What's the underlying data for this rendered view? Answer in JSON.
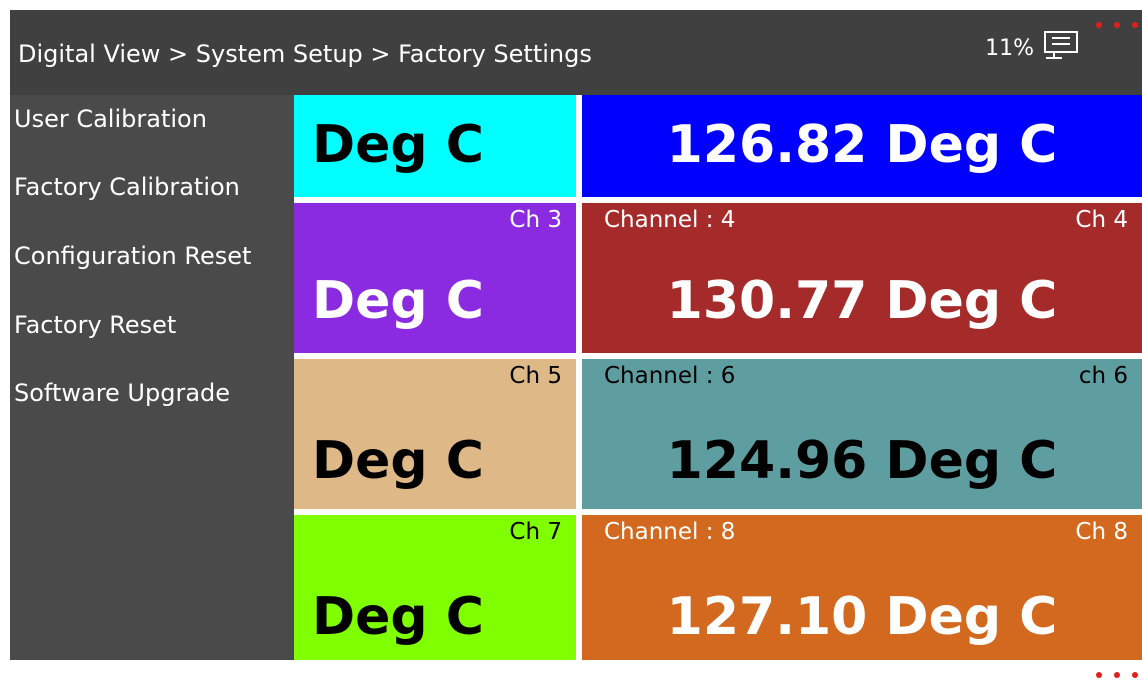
{
  "header": {
    "breadcrumb": "Digital View > System Setup  > Factory Settings",
    "battery": "11%",
    "monitor_icon": "monitor-network-icon"
  },
  "sidebar": {
    "items": [
      {
        "label": "User Calibration"
      },
      {
        "label": "Factory Calibration"
      },
      {
        "label": "Configuration Reset"
      },
      {
        "label": "Factory Reset"
      },
      {
        "label": "Software Upgrade"
      }
    ]
  },
  "tiles": [
    {
      "ch": "",
      "value": "Deg C",
      "color": "#00ffff",
      "text_color": "#000000"
    },
    {
      "ch_label": "",
      "ch": "",
      "value": "126.82 Deg C",
      "color": "#0000ff",
      "text_color": "#ffffff"
    },
    {
      "ch": "Ch 3",
      "value": "Deg C",
      "color": "#8a2be2",
      "text_color": "#ffffff"
    },
    {
      "ch_label": "Channel : 4",
      "ch": "Ch 4",
      "value": "130.77 Deg C",
      "color": "#a52a2a",
      "text_color": "#ffffff"
    },
    {
      "ch": "Ch 5",
      "value": "Deg C",
      "color": "#deb887",
      "text_color": "#000000"
    },
    {
      "ch_label": "Channel : 6",
      "ch": "ch 6",
      "value": "124.96 Deg C",
      "color": "#5f9ea0",
      "text_color": "#000000"
    },
    {
      "ch": "Ch 7",
      "value": "Deg C",
      "color": "#7fff00",
      "text_color": "#000000"
    },
    {
      "ch_label": "Channel : 8",
      "ch": "Ch 8",
      "value": "127.10 Deg C",
      "color": "#d2691e",
      "text_color": "#ffffff"
    }
  ],
  "colors": {
    "accent_dots": "#e0201b",
    "header_bg": "#404040",
    "sidebar_bg": "#4a4a4a"
  }
}
